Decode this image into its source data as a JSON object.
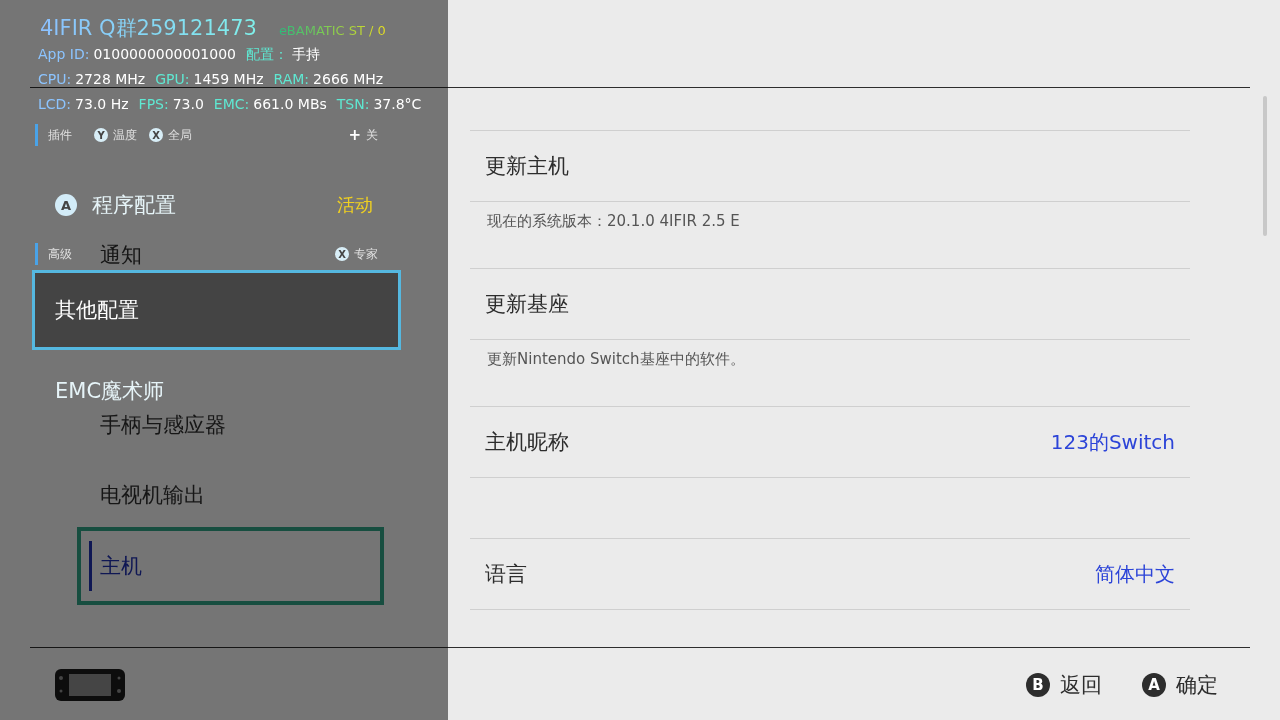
{
  "sidebar": {
    "groups": [
      [
        {
          "label": "通知",
          "selected": false
        }
      ],
      [
        {
          "label": "手柄与感应器",
          "selected": false
        },
        {
          "label": "电视机输出",
          "selected": false
        },
        {
          "label": "主机",
          "selected": true
        }
      ]
    ]
  },
  "settings": {
    "groups": [
      [
        {
          "kind": "title",
          "label": "更新主机"
        },
        {
          "kind": "description",
          "label": "现在的系统版本：20.1.0 4IFIR 2.5 E"
        },
        {
          "kind": "title",
          "label": "更新基座"
        },
        {
          "kind": "description",
          "label": "更新Nintendo Switch基座中的软件。"
        },
        {
          "kind": "title",
          "label": "主机昵称",
          "value": "123的Switch"
        }
      ],
      [
        {
          "kind": "title",
          "label": "语言",
          "value": "简体中文"
        }
      ]
    ]
  },
  "footer": {
    "buttons": [
      {
        "button": "B",
        "label": "返回"
      },
      {
        "button": "A",
        "label": "确定"
      }
    ]
  },
  "overlay": {
    "title": "4IFIR Q群259121473",
    "status": "eBAMATIC ST / 0",
    "stats": [
      [
        {
          "label": "App ID:",
          "value": "0100000000001000"
        },
        {
          "label": "配置：",
          "value": "手持"
        }
      ],
      [
        {
          "label": "CPU:",
          "value": "2728 MHz"
        },
        {
          "label": "GPU:",
          "value": "1459 MHz"
        },
        {
          "label": "RAM:",
          "value": "2666 MHz"
        }
      ],
      [
        {
          "label": "LCD:",
          "value": "73.0 Hz"
        },
        {
          "label": "FPS:",
          "value": "73.0"
        },
        {
          "label": "EMC:",
          "value": "661.0 MBs"
        },
        {
          "label": "TSN:",
          "value": "37.8°C"
        }
      ]
    ],
    "items": [
      {
        "kind": "section",
        "label": "插件",
        "hints": [
          {
            "button": "Y",
            "label": "温度"
          },
          {
            "button": "X",
            "label": "全局"
          },
          {
            "button": "+",
            "label": "关"
          }
        ]
      },
      {
        "kind": "item",
        "button": "A",
        "label": "程序配置",
        "value": "活动",
        "selected": false
      },
      {
        "kind": "section",
        "label": "高级",
        "hints": [
          {
            "button": "X",
            "label": "专家"
          }
        ]
      },
      {
        "kind": "item",
        "label": "其他配置",
        "selected": true
      },
      {
        "kind": "item",
        "label": "EMC魔术师",
        "selected": false
      }
    ]
  }
}
